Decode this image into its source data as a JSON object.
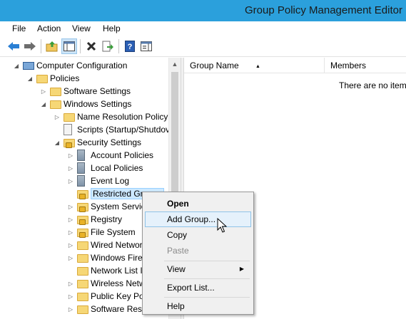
{
  "window": {
    "title": "Group Policy Management Editor"
  },
  "menubar": [
    "File",
    "Action",
    "View",
    "Help"
  ],
  "toolbar": [
    {
      "icon": "back-arrow-icon"
    },
    {
      "icon": "forward-arrow-icon"
    },
    {
      "icon": "up-folder-icon"
    },
    {
      "icon": "show-hide-tree-icon",
      "pressed": true
    },
    {
      "icon": "delete-x-icon"
    },
    {
      "icon": "export-list-icon"
    },
    {
      "icon": "help-icon"
    },
    {
      "icon": "properties-pane-icon"
    }
  ],
  "tree": {
    "items": [
      {
        "label": "Computer Configuration",
        "icon": "computer-icon",
        "expander": "expanded"
      },
      {
        "label": "Policies",
        "icon": "folder-icon",
        "expander": "expanded"
      },
      {
        "label": "Software Settings",
        "icon": "folder-icon",
        "expander": "collapsed"
      },
      {
        "label": "Windows Settings",
        "icon": "folder-icon",
        "expander": "expanded"
      },
      {
        "label": "Name Resolution Policy",
        "icon": "folder-icon",
        "expander": "collapsed"
      },
      {
        "label": "Scripts (Startup/Shutdov",
        "icon": "script-doc-icon",
        "expander": "none"
      },
      {
        "label": "Security Settings",
        "icon": "security-folder-icon",
        "expander": "expanded"
      },
      {
        "label": "Account Policies",
        "icon": "policy-icon",
        "expander": "collapsed"
      },
      {
        "label": "Local Policies",
        "icon": "policy-icon",
        "expander": "collapsed"
      },
      {
        "label": "Event Log",
        "icon": "policy-icon",
        "expander": "collapsed"
      },
      {
        "label": "Restricted Groups",
        "icon": "security-folder-icon",
        "expander": "none",
        "selected": true
      },
      {
        "label": "System Servic",
        "icon": "security-folder-icon",
        "expander": "collapsed"
      },
      {
        "label": "Registry",
        "icon": "security-folder-icon",
        "expander": "collapsed"
      },
      {
        "label": "File System",
        "icon": "security-folder-icon",
        "expander": "collapsed"
      },
      {
        "label": "Wired Networ",
        "icon": "folder-icon",
        "expander": "collapsed"
      },
      {
        "label": "Windows Fire",
        "icon": "folder-icon",
        "expander": "collapsed"
      },
      {
        "label": "Network List I",
        "icon": "folder-icon",
        "expander": "none"
      },
      {
        "label": "Wireless Netw",
        "icon": "folder-icon",
        "expander": "collapsed"
      },
      {
        "label": "Public Key Po",
        "icon": "folder-icon",
        "expander": "collapsed"
      },
      {
        "label": "Software Rest",
        "icon": "folder-icon",
        "expander": "collapsed"
      }
    ]
  },
  "list": {
    "columns": [
      "Group Name",
      "Members"
    ],
    "empty_message": "There are no item"
  },
  "context_menu": {
    "items": [
      {
        "label": "Open",
        "bold": true
      },
      {
        "label": "Add Group...",
        "highlighted": true
      },
      {
        "label": "Copy"
      },
      {
        "label": "Paste",
        "disabled": true
      },
      {
        "label": "View",
        "submenu": true
      },
      {
        "label": "Export List..."
      },
      {
        "label": "Help"
      }
    ]
  }
}
